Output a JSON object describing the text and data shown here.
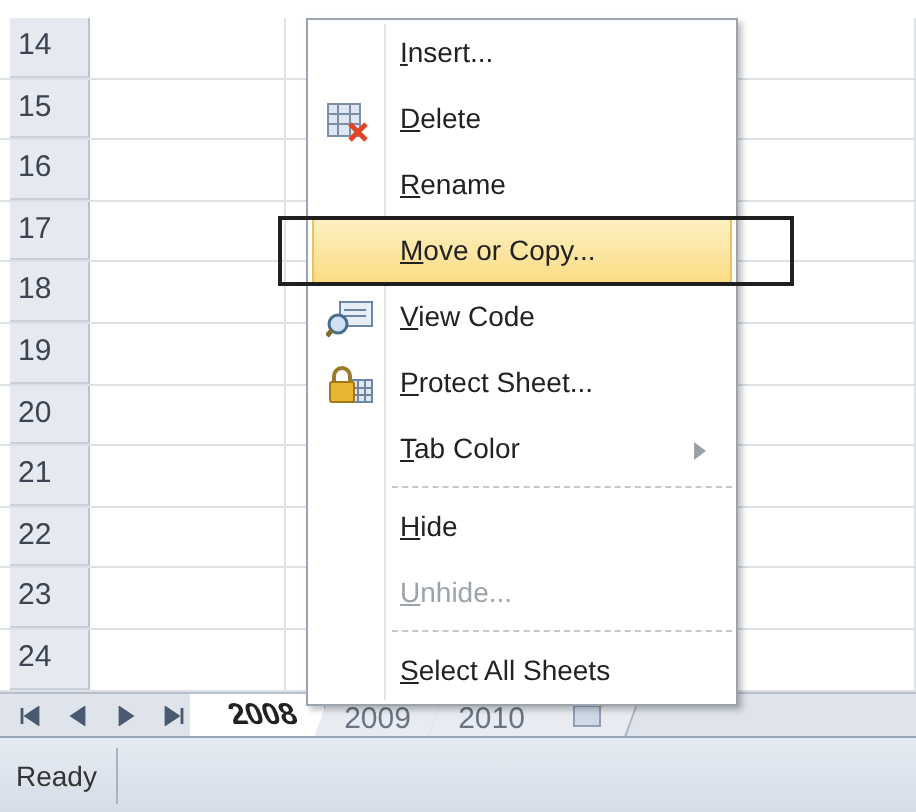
{
  "rows": [
    "14",
    "15",
    "16",
    "17",
    "18",
    "19",
    "20",
    "21",
    "22",
    "23",
    "24"
  ],
  "context_menu": {
    "items": [
      {
        "kind": "item",
        "key": "I",
        "rest": "nsert...",
        "selected": false,
        "disabled": false,
        "submenu": false,
        "framed": false
      },
      {
        "kind": "item",
        "key": "D",
        "rest": "elete",
        "selected": false,
        "disabled": false,
        "submenu": false,
        "framed": false
      },
      {
        "kind": "item",
        "key": "R",
        "rest": "ename",
        "selected": false,
        "disabled": false,
        "submenu": false,
        "framed": false
      },
      {
        "kind": "item",
        "key": "M",
        "rest": "ove or Copy...",
        "selected": true,
        "disabled": false,
        "submenu": false,
        "framed": true
      },
      {
        "kind": "item",
        "key": "V",
        "rest": "iew Code",
        "selected": false,
        "disabled": false,
        "submenu": false,
        "framed": false
      },
      {
        "kind": "item",
        "key": "P",
        "rest": "rotect Sheet...",
        "selected": false,
        "disabled": false,
        "submenu": false,
        "framed": false
      },
      {
        "kind": "item",
        "key": "T",
        "rest": "ab Color",
        "selected": false,
        "disabled": false,
        "submenu": true,
        "framed": false
      },
      {
        "kind": "separator"
      },
      {
        "kind": "item",
        "key": "H",
        "rest": "ide",
        "selected": false,
        "disabled": false,
        "submenu": false,
        "framed": false
      },
      {
        "kind": "item",
        "key": "U",
        "rest": "nhide...",
        "selected": false,
        "disabled": true,
        "submenu": false,
        "framed": false
      },
      {
        "kind": "separator"
      },
      {
        "kind": "item",
        "key": "S",
        "rest": "elect All Sheets",
        "selected": false,
        "disabled": false,
        "submenu": false,
        "framed": false
      }
    ]
  },
  "sheet_tabs": [
    {
      "kind": "sheet",
      "label": "2008",
      "selected": true
    },
    {
      "kind": "sheet",
      "label": "2009",
      "selected": false
    },
    {
      "kind": "sheet",
      "label": "2010",
      "selected": false
    },
    {
      "kind": "insert",
      "selected": false
    }
  ],
  "status_bar": {
    "text": "Ready"
  }
}
